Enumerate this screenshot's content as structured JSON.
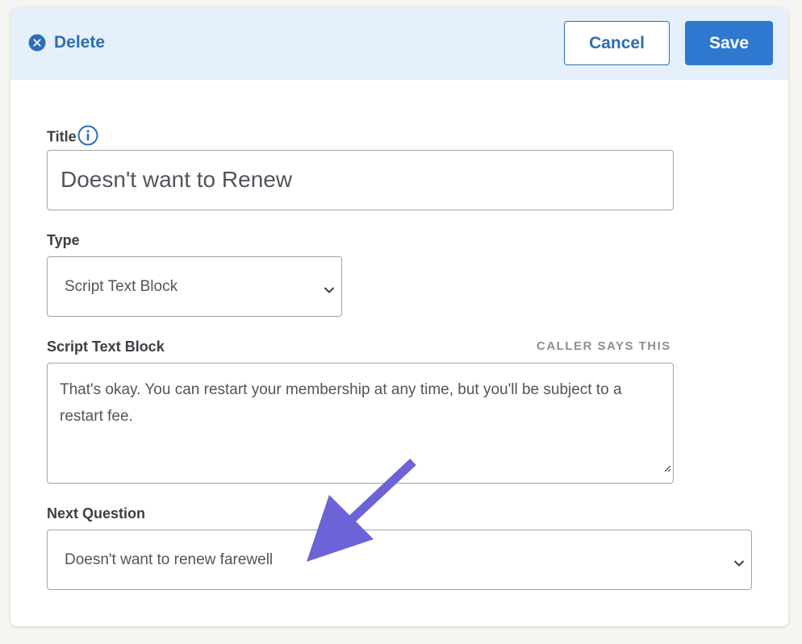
{
  "header": {
    "delete_label": "Delete",
    "cancel_label": "Cancel",
    "save_label": "Save"
  },
  "form": {
    "title": {
      "label": "Title",
      "value": "Doesn't want to Renew"
    },
    "type": {
      "label": "Type",
      "selected": "Script Text Block"
    },
    "script": {
      "label": "Script Text Block",
      "hint": "CALLER SAYS THIS",
      "value": "That's okay. You can restart your membership at any time, but you'll be subject to a restart fee."
    },
    "next_question": {
      "label": "Next Question",
      "selected": "Doesn't want to renew farewell"
    }
  },
  "annotation": {
    "type": "arrow",
    "color": "#6c63d6"
  },
  "colors": {
    "accent": "#2e6eb3",
    "save_bg": "#2f78d0",
    "header_bg": "#e5f0fb"
  }
}
